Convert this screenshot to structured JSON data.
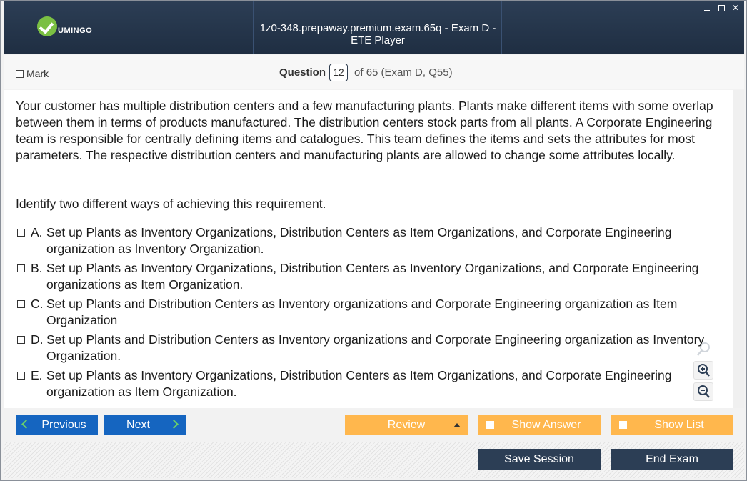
{
  "window": {
    "title": "1z0-348.prepaway.premium.exam.65q - Exam D - ETE Player",
    "logo_text": "UMINGO",
    "controls": [
      "minimize-icon",
      "maximize-icon",
      "close-icon"
    ],
    "close_glyph": "✕"
  },
  "question_bar": {
    "mark_label": "Mark",
    "question_label": "Question",
    "question_number": "12",
    "of_text": "of 65 (Exam D, Q55)"
  },
  "question": {
    "text": "Your customer has multiple distribution centers and a few manufacturing plants. Plants make different items with some overlap between them in terms of products manufactured. The distribution centers stock parts from all plants. A Corporate Engineering team is responsible for centrally defining items and catalogues. This team defines the items and sets the attributes for most parameters. The respective distribution centers and manufacturing plants are allowed to change some attributes locally.",
    "instruction": "Identify two different ways of achieving this requirement.",
    "options": [
      {
        "letter": "A.",
        "text": "Set up Plants as Inventory Organizations, Distribution Centers as Item Organizations, and Corporate Engineering organization as Inventory Organization."
      },
      {
        "letter": "B.",
        "text": "Set up Plants as Inventory Organizations, Distribution Centers as Inventory Organizations, and Corporate Engineering organizations as Item Organization."
      },
      {
        "letter": "C.",
        "text": "Set up Plants and Distribution Centers as Inventory organizations and Corporate Engineering organization as Item Organization"
      },
      {
        "letter": "D.",
        "text": "Set up Plants and Distribution Centers as Inventory organizations and Corporate Engineering organization as Inventory Organization."
      },
      {
        "letter": "E.",
        "text": "Set up Plants as Inventory Organizations, Distribution Centers as Item Organizations, and Corporate Engineering organization as Item Organization."
      }
    ]
  },
  "zoom": {
    "icons": [
      "search-icon",
      "zoom-in-icon",
      "zoom-out-icon"
    ]
  },
  "nav": {
    "previous_label": "Previous",
    "next_label": "Next",
    "review_label": "Review",
    "show_answer_label": "Show Answer",
    "show_list_label": "Show List"
  },
  "bottom": {
    "save_session_label": "Save Session",
    "end_exam_label": "End Exam"
  },
  "colors": {
    "titlebar": "#1f2e42",
    "nav_blue": "#1565c0",
    "nav_orange": "#ffb74d",
    "dark_button": "#2c3e55",
    "logo_green": "#7bc043",
    "arrow_green": "#6ad06a"
  }
}
